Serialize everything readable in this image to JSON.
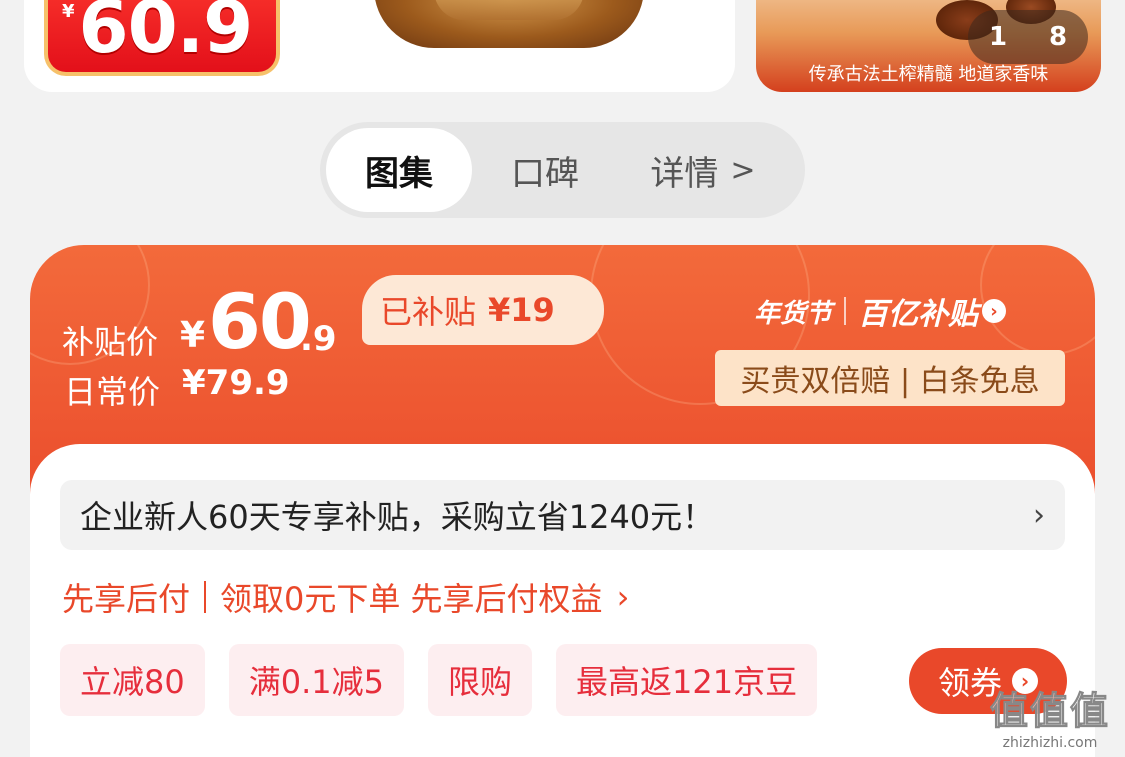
{
  "gallery": {
    "promo_currency": "¥",
    "promo_price": "60.9",
    "counter_current": "1",
    "counter_total": "8",
    "caption": "传承古法土榨精髓 地道家香味"
  },
  "tabs": [
    {
      "label": "图集"
    },
    {
      "label": "口碑"
    },
    {
      "label": "详情"
    }
  ],
  "tabs_chevron": ">",
  "price": {
    "subsidy_label": "补贴价",
    "currency": "¥",
    "integer": "60",
    "decimal": ".9",
    "subsidy_tag_label": "已补贴",
    "subsidy_amount": "¥19",
    "daily_label": "日常价",
    "daily_price": "¥79.9",
    "logo_festival": "年货节",
    "logo_program": "百亿补贴",
    "guarantee_text": "买贵双倍赔 | 白条免息"
  },
  "notice": {
    "text": "企业新人60天专享补贴，采购立省1240元！",
    "arrow": "›"
  },
  "bnpl": {
    "label": "先享后付",
    "text": "领取0元下单 先享后付权益",
    "arrow": "›"
  },
  "coupons": [
    {
      "label": "立减80"
    },
    {
      "label": "满0.1减5"
    },
    {
      "label": "限购"
    },
    {
      "label": "最高返121京豆"
    }
  ],
  "claim_button": {
    "label": "领券",
    "icon": "chevron-right-icon"
  },
  "watermark": {
    "big": "值值值",
    "small": "zhizhizhi.com"
  },
  "colors": {
    "accent": "#e9482a",
    "coupon_bg": "#fdeef0",
    "guarantee_bg": "#fde3c8"
  }
}
